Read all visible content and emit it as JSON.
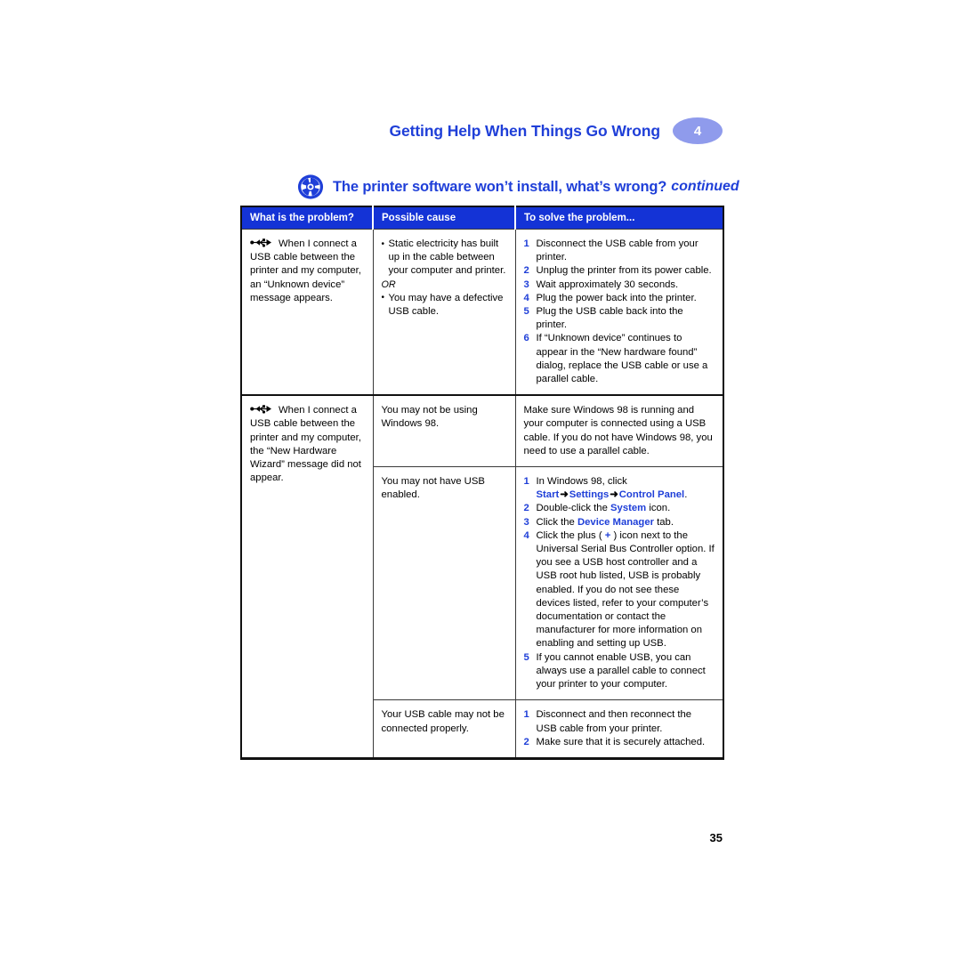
{
  "running_head": {
    "title": "Getting Help When Things Go Wrong",
    "chapter_badge": "4",
    "title_color": "#1F3FD8",
    "badge_color": "#8F9BEC"
  },
  "section": {
    "icon": "cd-disc-icon",
    "title": "The printer software won’t install, what’s wrong?",
    "continued": "continued",
    "color": "#1F3FD8"
  },
  "table": {
    "headers": {
      "col1": "What is the problem?",
      "col2": "Possible cause",
      "col3": "To solve the problem..."
    },
    "header_bg": "#1433D6",
    "rows": [
      {
        "problem_icon": "usb-symbol-icon",
        "problem": "When I connect a USB cable between the printer and my computer, an “Unknown device” message appears.",
        "cause_bullets": [
          "Static electricity has built up in the cable between your computer and printer.",
          "You may have a defective USB cable."
        ],
        "cause_separator": "OR",
        "steps": [
          "Disconnect the USB cable from your printer.",
          "Unplug the printer from its power cable.",
          "Wait approximately 30 seconds.",
          "Plug the power back into the printer.",
          "Plug the USB cable back into the printer.",
          "If “Unknown device” continues to appear in the “New hardware found” dialog, replace the USB cable or use a parallel cable."
        ]
      },
      {
        "problem_icon": "usb-symbol-icon",
        "problem": "When I connect a USB cable between the printer and my computer, the “New Hardware Wizard” message did not appear.",
        "cause": "You may not be using Windows 98.",
        "solution": "Make sure Windows 98 is running and your computer is connected using a USB cable. If you do not have Windows 98, you need to use a parallel cable."
      },
      {
        "cause": "You may not have USB enabled.",
        "steps": [
          {
            "prefix": "In Windows 98, click ",
            "kw1": "Start",
            "arrow1": "➜",
            "kw2": "Settings",
            "arrow2": "➜",
            "kw3": "Control Panel",
            "suffix": "."
          },
          {
            "prefix": "Double-click the ",
            "kw1": "System",
            "suffix": " icon."
          },
          {
            "prefix": "Click the ",
            "kw1": "Device Manager",
            "suffix": " tab."
          },
          {
            "prefix": "Click the plus ( ",
            "kw1": "+",
            "suffix": " ) icon next to the Universal Serial Bus Controller option. If you see a USB host controller and a USB root hub listed, USB is probably enabled. If you do not see these devices listed, refer to your computer’s documentation or contact the manufacturer for more information on enabling and setting up USB."
          },
          {
            "prefix": "If you cannot enable USB, you can always use a parallel cable to connect your printer to your computer."
          }
        ]
      },
      {
        "cause": "Your USB cable may not be connected properly.",
        "steps": [
          "Disconnect and then reconnect the USB cable from your printer.",
          "Make sure that it is securely attached."
        ]
      }
    ]
  },
  "folio": {
    "page_number": "35"
  }
}
